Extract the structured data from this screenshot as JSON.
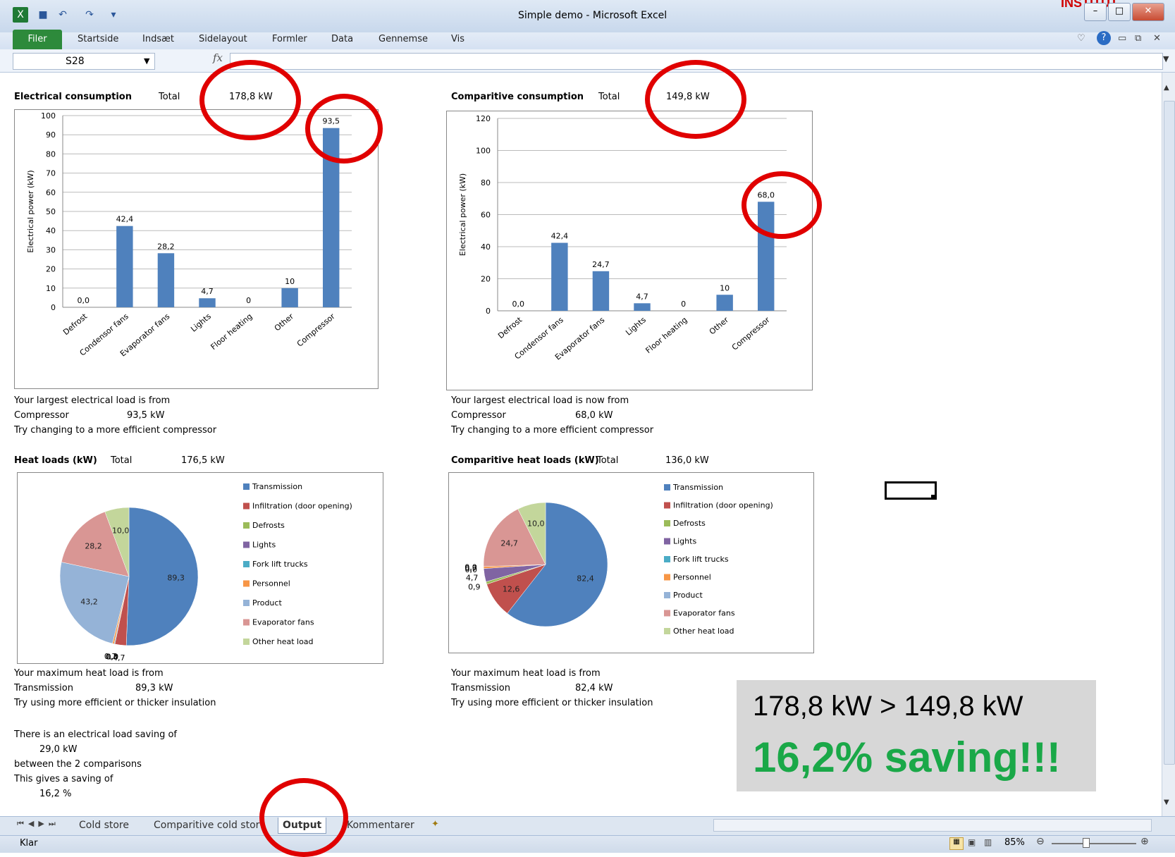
{
  "window": {
    "title": "Simple demo  -  Microsoft Excel",
    "corner_text": "INSTITUT"
  },
  "ribbon": {
    "file_tab": "Filer",
    "tabs": [
      "Startside",
      "Indsæt",
      "Sidelayout",
      "Formler",
      "Data",
      "Gennemse",
      "Vis"
    ]
  },
  "formula_bar": {
    "name_box": "S28",
    "fx_symbol": "fx",
    "value": ""
  },
  "electrical": {
    "title": "Electrical consumption",
    "total_label": "Total",
    "total_value": "178,8  kW",
    "msg1": "Your largest electrical load is from",
    "largest_name": "Compressor",
    "largest_value": "93,5  kW",
    "msg3": "Try changing to a more efficient compressor"
  },
  "comparative": {
    "title": "Comparitive consumption",
    "total_label": "Total",
    "total_value": "149,8  kW",
    "msg1": "Your largest electrical load is now from",
    "largest_name": "Compressor",
    "largest_value": "68,0  kW",
    "msg3": "Try changing to a more efficient compressor"
  },
  "heat": {
    "title": "Heat loads (kW)",
    "total_label": "Total",
    "total_value": "176,5  kW",
    "msg1": "Your maximum heat load is from",
    "max_name": "Transmission",
    "max_value": "89,3  kW",
    "msg3": "Try using more efficient or thicker insulation"
  },
  "comp_heat": {
    "title": "Comparitive heat loads (kW)",
    "total_label": "Total",
    "total_value": "136,0  kW",
    "msg1": "Your maximum heat load is from",
    "max_name": "Transmission",
    "max_value": "82,4  kW",
    "msg3": "Try using more efficient or thicker insulation"
  },
  "savings": {
    "line1": "There is an electrical load saving of",
    "line2": "29,0  kW",
    "line3": "between the 2 comparisons",
    "line4": "This gives a saving of",
    "line5": "16,2  %"
  },
  "callout": {
    "line1": "178,8 kW > 149,8 kW",
    "line2": "16,2% saving!!!"
  },
  "sheet_tabs": [
    "Cold store",
    "Comparitive cold stor",
    "Output",
    "Kommentarer"
  ],
  "active_tab": "Output",
  "status": {
    "ready": "Klar",
    "zoom": "85%"
  },
  "colors": {
    "bar": "#4f81bd",
    "annotation_red": "#e00000",
    "saving_green": "#1aa848",
    "excel_green": "#2d8a3b"
  },
  "chart_data": [
    {
      "type": "bar",
      "categories": [
        "Defrost",
        "Condensor fans",
        "Evaporator fans",
        "Lights",
        "Floor heating",
        "Other",
        "Compressor"
      ],
      "values": [
        0.0,
        42.4,
        28.2,
        4.7,
        0,
        10,
        93.5
      ],
      "value_labels": [
        "0,0",
        "42,4",
        "28,2",
        "4,7",
        "0",
        "10",
        "93,5"
      ],
      "ylabel": "Electrical power (kW)",
      "ylim": [
        0,
        100
      ],
      "yticks": [
        0,
        10,
        20,
        30,
        40,
        50,
        60,
        70,
        80,
        90,
        100
      ],
      "grid": true
    },
    {
      "type": "bar",
      "categories": [
        "Defrost",
        "Condensor fans",
        "Evaporator fans",
        "Lights",
        "Floor heating",
        "Other",
        "Compressor"
      ],
      "values": [
        0.0,
        42.4,
        24.7,
        4.7,
        0,
        10,
        68.0
      ],
      "value_labels": [
        "0,0",
        "42,4",
        "24,7",
        "4,7",
        "0",
        "10",
        "68,0"
      ],
      "ylabel": "Electrical power (kW)",
      "ylim": [
        0,
        120
      ],
      "yticks": [
        0,
        20,
        40,
        60,
        80,
        100,
        120
      ],
      "grid": true
    },
    {
      "type": "pie",
      "categories": [
        "Transmission",
        "Infiltration (door opening)",
        "Defrosts",
        "Lights",
        "Fork lift trucks",
        "Personnel",
        "Product",
        "Evaporator fans",
        "Other heat load"
      ],
      "values": [
        89.3,
        4.7,
        0.0,
        0.0,
        0.3,
        0.7,
        43.2,
        28.2,
        10.0
      ],
      "value_labels": [
        "89,3",
        "4,7",
        "0,0",
        "0,0",
        "0,3",
        "0,7",
        "43,2",
        "28,2",
        "10,0"
      ],
      "colors": [
        "#4f81bd",
        "#c0504d",
        "#9bbb59",
        "#8064a2",
        "#4bacc6",
        "#f79646",
        "#95b3d7",
        "#d99694",
        "#c3d69b"
      ],
      "legend": "right"
    },
    {
      "type": "pie",
      "categories": [
        "Transmission",
        "Infiltration (door opening)",
        "Defrosts",
        "Lights",
        "Fork lift trucks",
        "Personnel",
        "Product",
        "Evaporator fans",
        "Other heat load"
      ],
      "values": [
        82.4,
        12.6,
        0.9,
        4.7,
        0.0,
        0.7,
        0.0,
        24.7,
        10.0
      ],
      "value_labels": [
        "82,4",
        "12,6",
        "0,9",
        "4,7",
        "0,0",
        "0,7",
        "0,0",
        "24,7",
        "10,0"
      ],
      "colors": [
        "#4f81bd",
        "#c0504d",
        "#9bbb59",
        "#8064a2",
        "#4bacc6",
        "#f79646",
        "#95b3d7",
        "#d99694",
        "#c3d69b"
      ],
      "legend": "right"
    }
  ]
}
